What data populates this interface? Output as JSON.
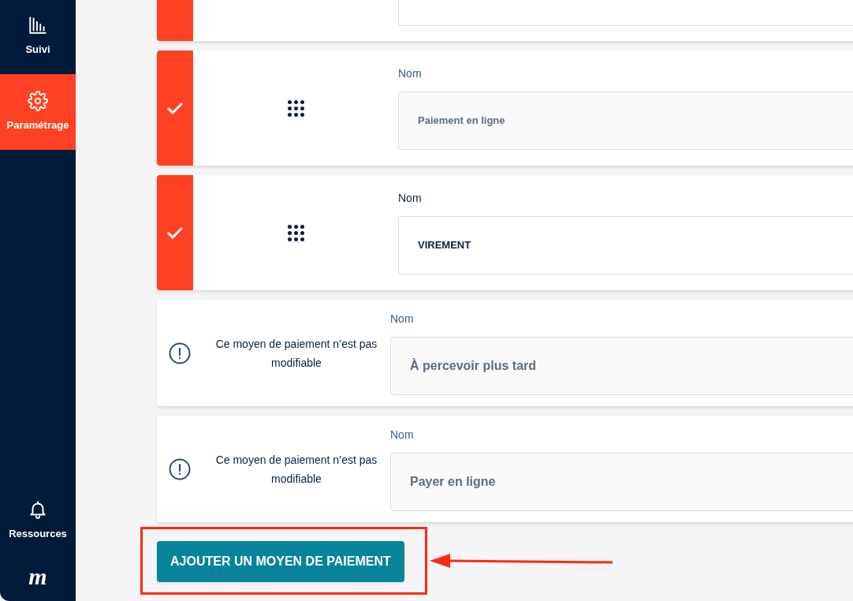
{
  "sidebar": {
    "items": [
      {
        "label": "Suivi",
        "selected": false
      },
      {
        "label": "Paramétrage",
        "selected": true
      }
    ],
    "bottom_items": [
      {
        "label": "Ressources",
        "selected": false
      }
    ],
    "logo": "m"
  },
  "payment_methods": [
    {
      "kind": "partial",
      "checked": true
    },
    {
      "kind": "editable",
      "checked": true,
      "label": "Nom",
      "value": "Paiement en ligne",
      "disabled": true
    },
    {
      "kind": "editable",
      "checked": true,
      "label": "Nom",
      "value": "VIREMENT",
      "disabled": false
    },
    {
      "kind": "locked",
      "message": "Ce moyen de paiement n’est pas modifiable",
      "label": "Nom",
      "value": "À percevoir plus tard"
    },
    {
      "kind": "locked",
      "message": "Ce moyen de paiement n’est pas modifiable",
      "label": "Nom",
      "value": "Payer en ligne"
    }
  ],
  "add_button": {
    "label": "AJOUTER UN MOYEN DE PAIEMENT",
    "highlighted": true
  }
}
